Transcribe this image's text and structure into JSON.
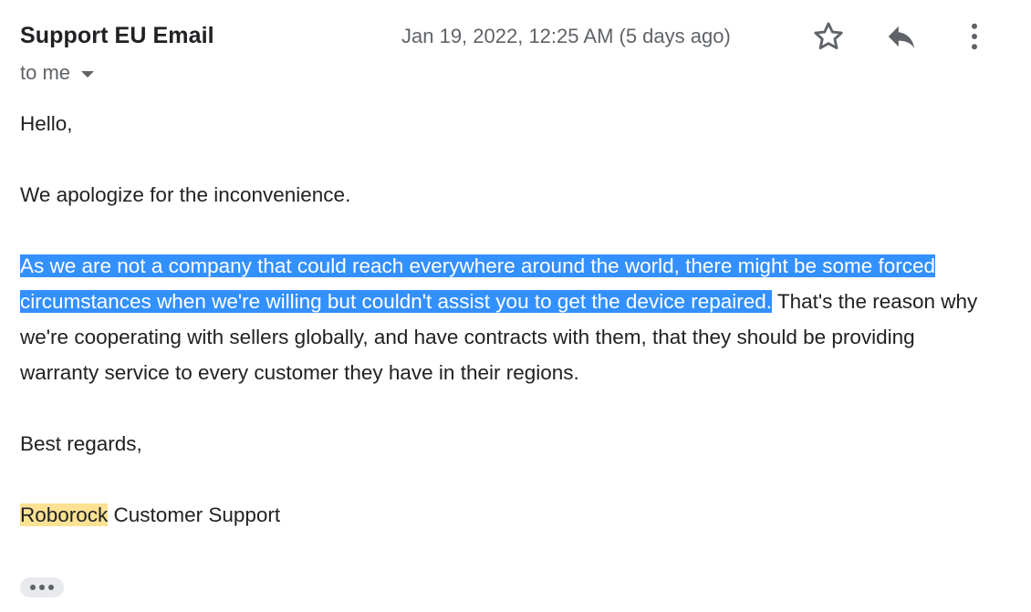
{
  "email": {
    "sender": "Support EU Email",
    "recipient": "to me",
    "date": "Jan 19, 2022, 12:25 AM (5 days ago)",
    "actions": {
      "star_icon": "star-outline-icon",
      "reply_icon": "reply-icon",
      "more_icon": "more-vertical-icon"
    },
    "body": {
      "greeting": "Hello,",
      "apology": "We apologize for the inconvenience.",
      "selected_text": "As we are not a company that could reach everywhere around the world, there might be some forced circumstances when we're willing but couldn't assist you to get the device repaired.",
      "continuation": " That's the reason why we're cooperating with sellers globally, and have contracts with them, that they should be providing warranty service to every customer they have in their regions.",
      "closing": "Best regards,",
      "signature_brand": "Roborock",
      "signature_rest": " Customer Support"
    },
    "colors": {
      "selection": "#3390ff",
      "search_highlight": "#fde293",
      "secondary_text": "#5f6368",
      "primary_text": "#202124"
    }
  }
}
